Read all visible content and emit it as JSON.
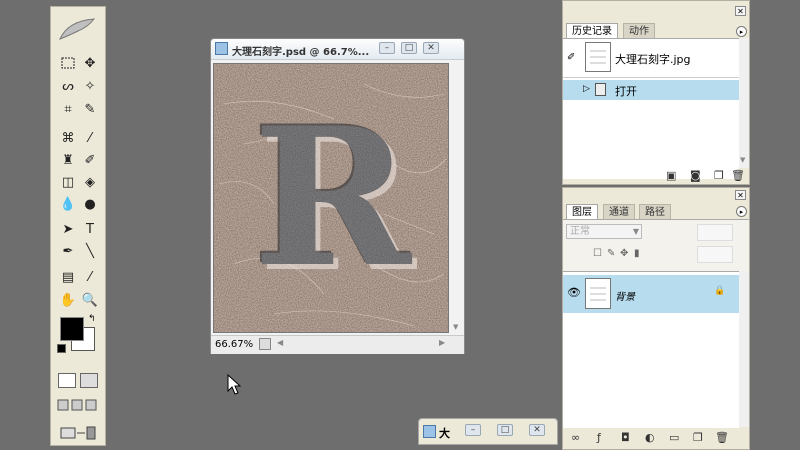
{
  "document": {
    "title": "大理石刻字.psd @ 66.7%...",
    "zoom": "66.67%",
    "letter": "R"
  },
  "history_panel": {
    "tabs": [
      "历史记录",
      "动作"
    ],
    "snapshot_label": "大理石刻字.jpg",
    "items": [
      "打开"
    ]
  },
  "layers_panel": {
    "tabs": [
      "图层",
      "通道",
      "路径"
    ],
    "blend_mode": "正常",
    "layer_name": "背景"
  },
  "taskbar": {
    "label": "大"
  },
  "colors": {
    "workspace": "#6e6e6e",
    "panel": "#ece9d8",
    "selection": "#b7dcee",
    "foreground": "#000000",
    "background": "#ffffff"
  },
  "icons": {
    "eye": "eye-icon",
    "lock": "lock-icon",
    "play": "play-icon",
    "cursor": "mouse-cursor-icon"
  }
}
